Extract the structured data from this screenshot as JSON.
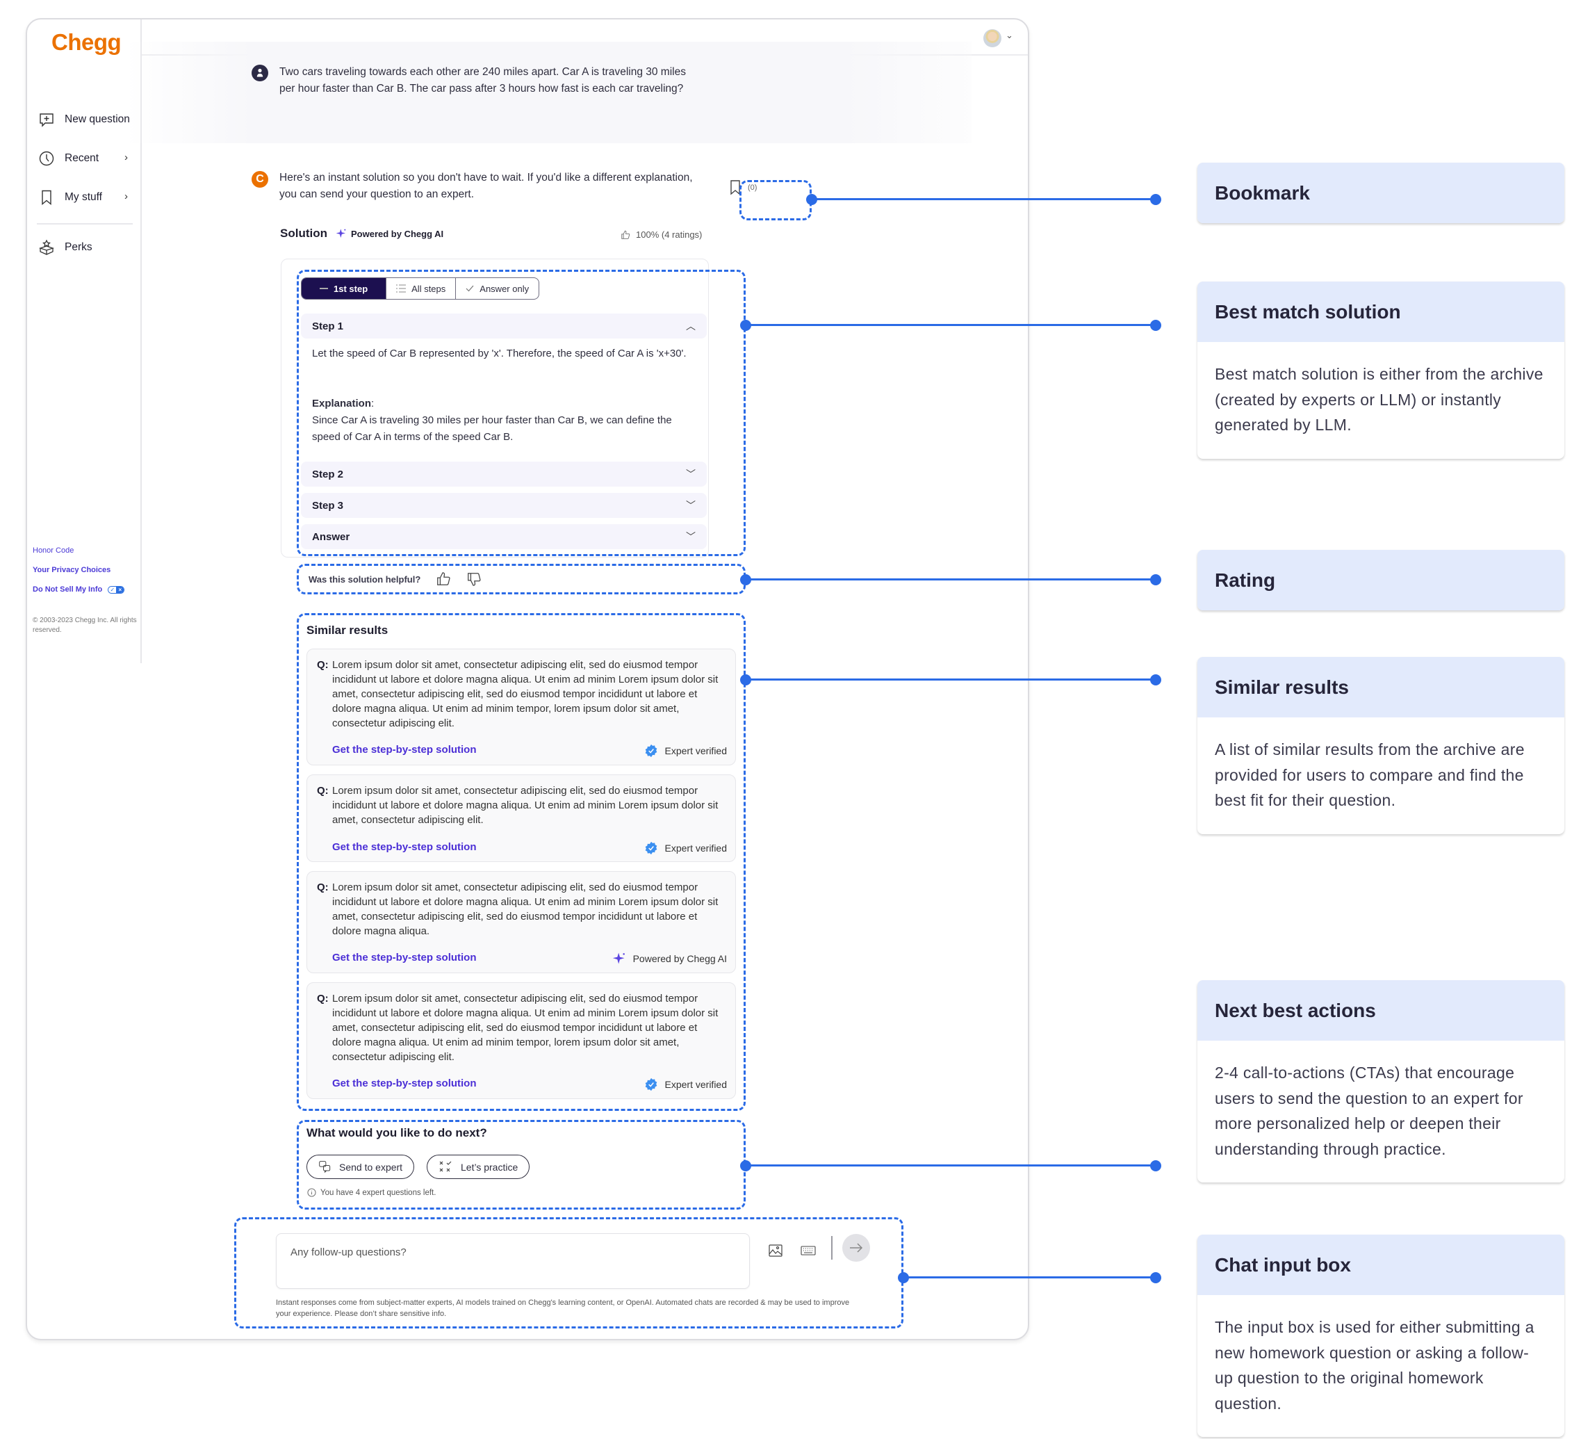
{
  "app": {
    "logo": "Chegg",
    "brand_color": "#eb7100",
    "accent_color": "#2b6be6"
  },
  "sidebar": {
    "items": [
      {
        "label": "New question",
        "icon": "chat-plus-icon",
        "has_chevron": false
      },
      {
        "label": "Recent",
        "icon": "clock-icon",
        "has_chevron": true
      },
      {
        "label": "My stuff",
        "icon": "bookmark-icon",
        "has_chevron": true
      },
      {
        "label": "Perks",
        "icon": "gift-box-icon",
        "has_chevron": false
      }
    ],
    "chevron": "›",
    "footer": {
      "honor_code": "Honor Code",
      "privacy_choices": "Your Privacy Choices",
      "do_not_sell": "Do Not Sell My Info",
      "toggle_check": "✓",
      "toggle_x": "×",
      "copyright": "© 2003-2023 Chegg Inc. All rights reserved."
    }
  },
  "header": {
    "avatar_chevron": "⌄"
  },
  "question": {
    "text": "Two cars traveling towards each other are 240 miles apart. Car A is traveling 30 miles per hour faster than Car B. The car pass after 3 hours how fast is each car traveling?"
  },
  "answer": {
    "avatar_letter": "C",
    "intro": "Here's an instant solution so you don't have to wait. If you'd like a different explanation, you can send your question to an expert.",
    "bookmark_count": "(0)"
  },
  "solution": {
    "title": "Solution",
    "powered_by": "Powered by Chegg AI",
    "rating": "100% (4 ratings)",
    "view_tabs": [
      {
        "label": "1st step",
        "active": true
      },
      {
        "label": "All steps",
        "active": false
      },
      {
        "label": "Answer only",
        "active": false
      }
    ],
    "steps": [
      {
        "label": "Step 1",
        "expanded": true,
        "chevron": "︿"
      },
      {
        "label": "Step 2",
        "expanded": false,
        "chevron": "﹀"
      },
      {
        "label": "Step 3",
        "expanded": false,
        "chevron": "﹀"
      },
      {
        "label": "Answer",
        "expanded": false,
        "chevron": "﹀"
      }
    ],
    "step1_body": "Let the speed of Car B represented by 'x'. Therefore, the speed of Car A is 'x+30'.",
    "explanation_label": "Explanation",
    "explanation_colon": ":",
    "explanation_body": "Since Car A is traveling 30 miles per hour faster than Car B, we can define the speed of Car A in terms of the speed Car B."
  },
  "feedback": {
    "question": "Was this solution helpful?"
  },
  "similar": {
    "title": "Similar results",
    "q_label": "Q:",
    "link_label": "Get the step-by-step solution",
    "items": [
      {
        "text": "Lorem ipsum dolor sit amet, consectetur adipiscing elit, sed do eiusmod tempor incididunt ut labore et dolore magna aliqua. Ut enim ad minim Lorem ipsum dolor sit amet, consectetur adipiscing elit, sed do eiusmod tempor incididunt ut labore et dolore magna aliqua. Ut enim ad minim tempor, lorem ipsum dolor sit amet, consectetur adipiscing elit.",
        "badge": "Expert verified",
        "badge_type": "expert"
      },
      {
        "text": "Lorem ipsum dolor sit amet, consectetur adipiscing elit, sed do eiusmod tempor incididunt ut labore et dolore magna aliqua. Ut enim ad minim Lorem ipsum dolor sit amet, consectetur adipiscing elit.",
        "badge": "Expert verified",
        "badge_type": "expert"
      },
      {
        "text": "Lorem ipsum dolor sit amet, consectetur adipiscing elit, sed do eiusmod tempor incididunt ut labore et dolore magna aliqua. Ut enim ad minim Lorem ipsum dolor sit amet, consectetur adipiscing elit, sed do eiusmod tempor incididunt ut labore et dolore magna aliqua.",
        "badge": "Powered by Chegg AI",
        "badge_type": "ai"
      },
      {
        "text": "Lorem ipsum dolor sit amet, consectetur adipiscing elit, sed do eiusmod tempor incididunt ut labore et dolore magna aliqua. Ut enim ad minim Lorem ipsum dolor sit amet, consectetur adipiscing elit, sed do eiusmod tempor incididunt ut labore et dolore magna aliqua. Ut enim ad minim tempor, lorem ipsum dolor sit amet, consectetur adipiscing elit.",
        "badge": "Expert verified",
        "badge_type": "expert"
      }
    ]
  },
  "next_actions": {
    "title": "What would you like to do next?",
    "buttons": [
      {
        "label": "Send to expert",
        "icon": "qa-bubbles-icon"
      },
      {
        "label": "Let’s practice",
        "icon": "practice-marks-icon"
      }
    ],
    "note": "You have 4 expert questions left."
  },
  "chat": {
    "placeholder": "Any follow-up questions?",
    "disclaimer": "Instant responses come from subject-matter experts, AI models trained on Chegg's learning content, or OpenAI. Automated chats are recorded & may be used to improve your experience. Please don’t share sensitive info."
  },
  "annotations": [
    {
      "title": "Bookmark",
      "body": ""
    },
    {
      "title": "Best match solution",
      "body": "Best match solution is either from the archive (created by experts or LLM) or instantly generated by LLM."
    },
    {
      "title": "Rating",
      "body": ""
    },
    {
      "title": "Similar results",
      "body": "A list of similar results from the archive are provided for users to compare and find the best fit for their question."
    },
    {
      "title": "Next best actions",
      "body": "2-4 call-to-actions (CTAs) that encourage users to send the question to an expert for more personalized help or deepen their understanding through practice."
    },
    {
      "title": "Chat input box",
      "body": "The input box is used for either submitting a new homework question or asking a follow-up question to the original homework question."
    }
  ]
}
